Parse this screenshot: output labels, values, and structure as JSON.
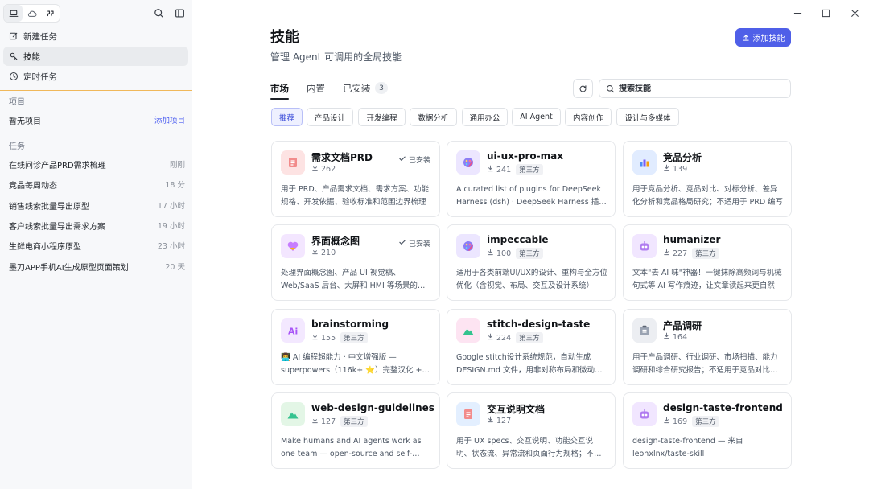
{
  "sidebar": {
    "nav": [
      {
        "label": "新建任务",
        "icon": "edit-icon"
      },
      {
        "label": "技能",
        "icon": "skills-icon"
      },
      {
        "label": "定时任务",
        "icon": "clock-icon"
      }
    ],
    "projects_label": "项目",
    "projects_empty": "暂无项目",
    "add_project": "添加项目",
    "tasks_label": "任务",
    "tasks": [
      {
        "title": "在线问诊产品PRD需求梳理",
        "time": "刚刚"
      },
      {
        "title": "竞品每周动态",
        "time": "18 分"
      },
      {
        "title": "销售线索批量导出原型",
        "time": "17 小时"
      },
      {
        "title": "客户线索批量导出需求方案",
        "time": "19 小时"
      },
      {
        "title": "生鲜电商小程序原型",
        "time": "23 小时"
      },
      {
        "title": "墨刀APP手机AI生成原型页面策划",
        "time": "20 天"
      }
    ]
  },
  "main": {
    "title": "技能",
    "subtitle": "管理 Agent 可调用的全局技能",
    "add_button": "添加技能",
    "tabs": [
      {
        "label": "市场"
      },
      {
        "label": "内置"
      },
      {
        "label": "已安装"
      }
    ],
    "installed_count": "3",
    "search_placeholder": "搜索技能",
    "chips": [
      "推荐",
      "产品设计",
      "开发编程",
      "数据分析",
      "通用办公",
      "AI Agent",
      "内容创作",
      "设计与多媒体"
    ],
    "installed_label": "已安装",
    "third_party_label": "第三方",
    "cards": [
      {
        "name": "需求文档PRD",
        "downloads": "262",
        "installed": true,
        "third": false,
        "desc": "用于 PRD、产品需求文档、需求方案、功能规格、开发依据、验收标准和范围边界梳理",
        "icon": "document-icon",
        "color": "#fde3e3"
      },
      {
        "name": "ui-ux-pro-max",
        "downloads": "241",
        "installed": false,
        "third": true,
        "desc": "A curated list of plugins for DeepSeek Harness (dsh) · DeepSeek Harness 插件精选",
        "icon": "palette-icon",
        "color": "#ece6ff"
      },
      {
        "name": "竞品分析",
        "downloads": "139",
        "installed": false,
        "third": false,
        "desc": "用于竞品分析、竞品对比、对标分析、差异化分析和竞品格局研究；不适用于 PRD 编写",
        "icon": "chart-icon",
        "color": "#e1ecff"
      },
      {
        "name": "界面概念图",
        "downloads": "210",
        "installed": true,
        "third": false,
        "desc": "处理界面概念图、产品 UI 视觉稿、Web/SaaS 后台、大屏和 HMI 等场景的视觉设计",
        "icon": "heart-icon",
        "color": "#f3e6ff"
      },
      {
        "name": "impeccable",
        "downloads": "100",
        "installed": false,
        "third": true,
        "desc": "适用于各类前端UI/UX的设计、重构与全方位优化（含视觉、布局、交互及设计系统）",
        "icon": "palette-icon",
        "color": "#ece6ff"
      },
      {
        "name": "humanizer",
        "downloads": "227",
        "installed": false,
        "third": true,
        "desc": "文本\"去 AI 味\"神器！一键抹除高频词与机械句式等 AI 写作痕迹，让文章读起来更自然",
        "icon": "robot-icon",
        "color": "#f1e6ff"
      },
      {
        "name": "brainstorming",
        "downloads": "155",
        "installed": false,
        "third": true,
        "desc": "👩‍💻 AI 编程超能力 · 中文增强版 — superpowers（116k+ ⭐）完整汉化 + 中国特色",
        "icon": "ai-icon",
        "color": "#f3e8ff"
      },
      {
        "name": "stitch-design-taste",
        "downloads": "224",
        "installed": false,
        "third": true,
        "desc": "Google stitch设计系统规范，自动生成 DESIGN.md 文件，用非对称布局和微动效打造高级感",
        "icon": "mountain-icon",
        "color": "#fde4f2"
      },
      {
        "name": "产品调研",
        "downloads": "164",
        "installed": false,
        "third": false,
        "desc": "用于产品调研、行业调研、市场扫描、能力调研和综合研究报告；不适用于竞品对比分析",
        "icon": "clipboard-icon",
        "color": "#eceef2"
      },
      {
        "name": "web-design-guidelines",
        "downloads": "127",
        "installed": false,
        "third": true,
        "desc": "Make humans and AI agents work as one team — open-source and self-hosted",
        "icon": "mountain-icon",
        "color": "#e3f6e6"
      },
      {
        "name": "交互说明文档",
        "downloads": "127",
        "installed": false,
        "third": false,
        "desc": "用于 UX specs、交互说明、功能交互说明、状态流、异常流和页面行为规格；不适用于视觉设计",
        "icon": "document-icon",
        "color": "#e3efff"
      },
      {
        "name": "design-taste-frontend",
        "downloads": "169",
        "installed": false,
        "third": true,
        "desc": "design-taste-frontend — 来自 leonxlnx/taste-skill",
        "icon": "robot-icon",
        "color": "#f1e6ff"
      }
    ]
  }
}
